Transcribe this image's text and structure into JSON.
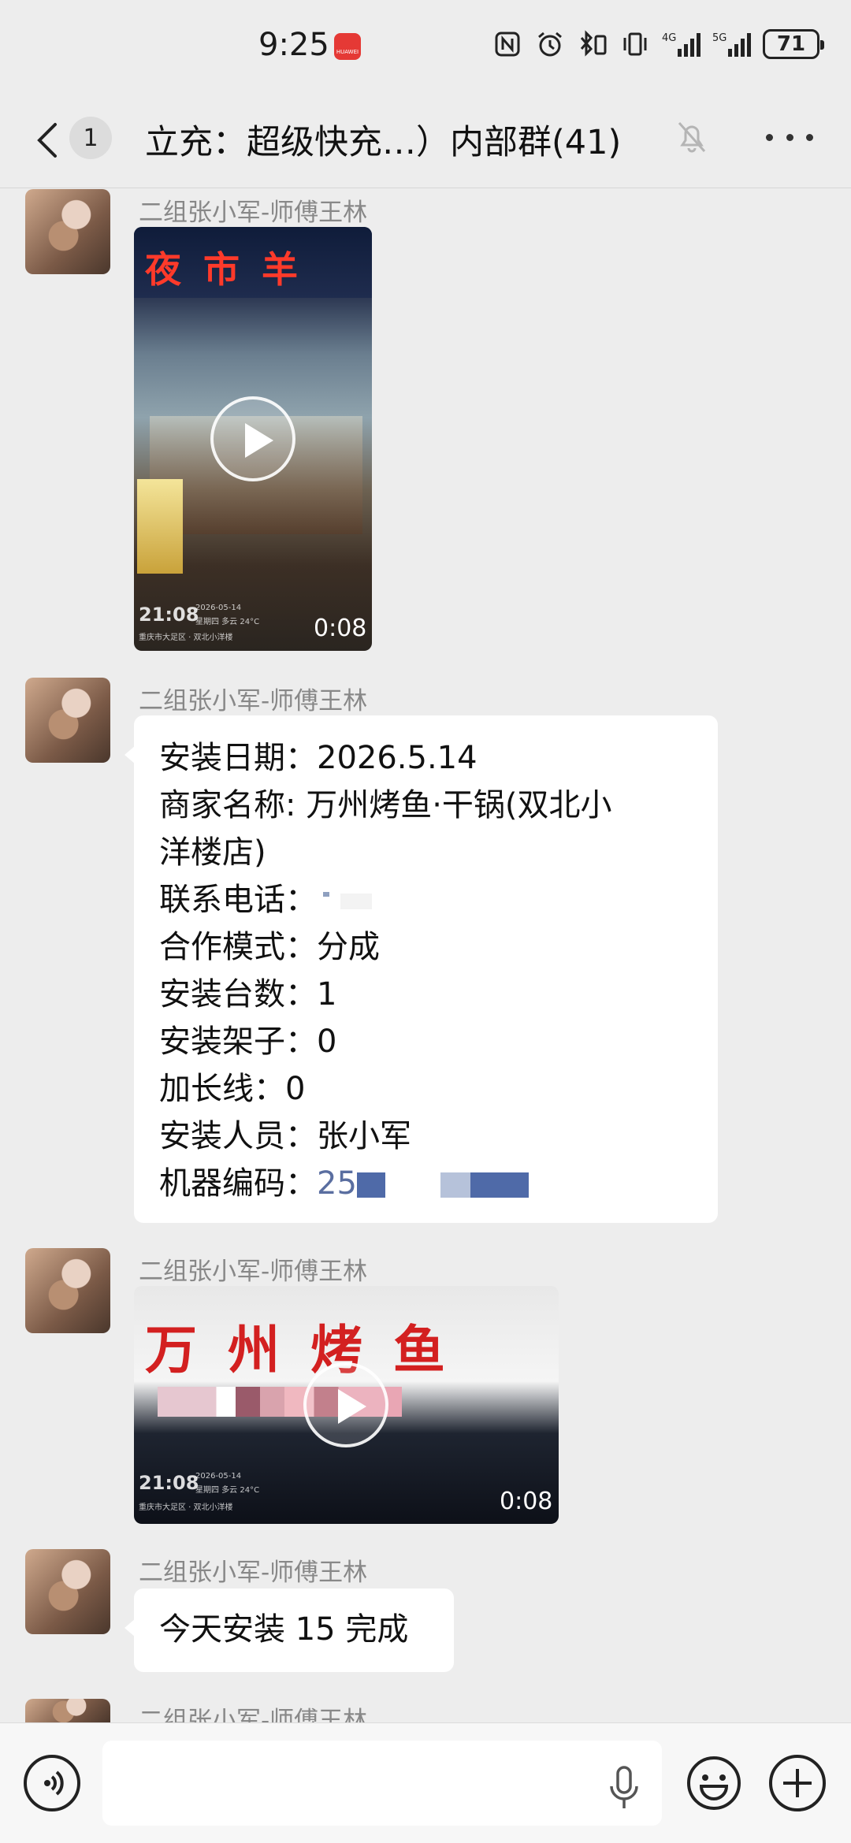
{
  "status_bar": {
    "time": "9:25",
    "app_badge": "HUAWEI",
    "signal_4g": "4G",
    "signal_5g": "5G",
    "battery": "71"
  },
  "header": {
    "unread_count": "1",
    "title": "立充：超级快充…）内部群(41)"
  },
  "messages": [
    {
      "sender": "二组张小军-师傅王林",
      "type": "video",
      "sign_text": "夜 市 羊",
      "stamp_time": "21:08",
      "stamp_date": "2026-05-14",
      "stamp_weather": "星期四 多云 24°C",
      "stamp_location": "重庆市大足区 · 双北小洋楼",
      "duration": "0:08"
    },
    {
      "sender": "二组张小军-师傅王林",
      "type": "text",
      "lines": [
        "安装日期：2026.5.14",
        "商家名称: 万州烤鱼·干锅(双北小",
        "洋楼店)",
        "联系电话：",
        "合作模式：分成",
        "安装台数：1",
        "安装架子：0",
        "加长线：0",
        "安装人员：张小军",
        "机器编码："
      ],
      "code_prefix": "25"
    },
    {
      "sender": "二组张小军-师傅王林",
      "type": "video",
      "sign_text": "万 州 烤 鱼",
      "stamp_time": "21:08",
      "stamp_date": "2026-05-14",
      "stamp_weather": "星期四 多云 24°C",
      "stamp_location": "重庆市大足区 · 双北小洋楼",
      "duration": "0:08"
    },
    {
      "sender": "二组张小军-师傅王林",
      "type": "text",
      "text": "今天安装 15 完成"
    },
    {
      "sender": "二组张小军-师傅王林"
    }
  ],
  "icons": [
    "back-chevron-icon",
    "mute-bell-icon",
    "more-icon",
    "voice-icon",
    "mic-icon",
    "emoji-icon",
    "plus-icon"
  ]
}
